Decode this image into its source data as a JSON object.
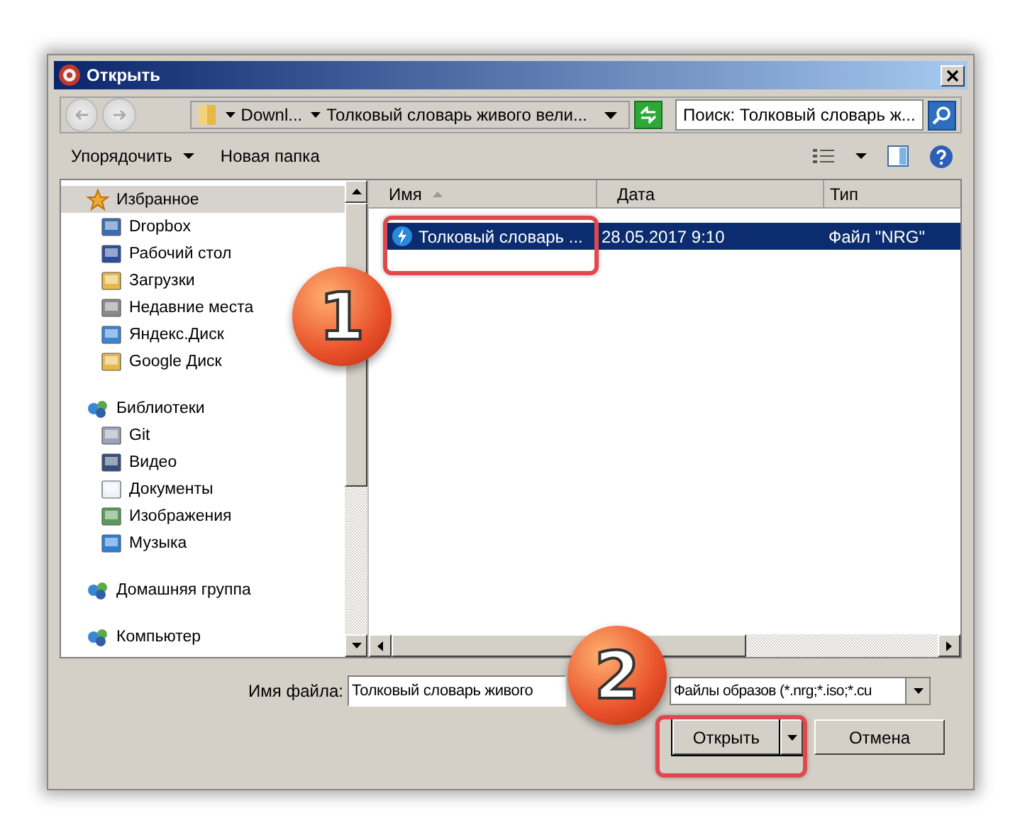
{
  "window": {
    "title": "Открыть"
  },
  "address": {
    "crumbs": [
      "Downl...",
      "Толковый словарь живого вели..."
    ]
  },
  "search": {
    "placeholder": "Поиск: Толковый словарь ж..."
  },
  "toolbar": {
    "organize": "Упорядочить",
    "new_folder": "Новая папка"
  },
  "nav": [
    {
      "label": "Избранное",
      "selected": true,
      "children": [
        {
          "label": "Dropbox",
          "selected": false
        },
        {
          "label": "Рабочий стол",
          "selected": false
        },
        {
          "label": "Загрузки",
          "selected": false
        },
        {
          "label": "Недавние места",
          "selected": false
        },
        {
          "label": "Яндекс.Диск",
          "selected": false
        },
        {
          "label": "Google Диск",
          "selected": false
        }
      ]
    },
    {
      "label": "Библиотеки",
      "selected": false,
      "children": [
        {
          "label": "Git",
          "selected": false
        },
        {
          "label": "Видео",
          "selected": false
        },
        {
          "label": "Документы",
          "selected": false
        },
        {
          "label": "Изображения",
          "selected": false
        },
        {
          "label": "Музыка",
          "selected": false
        }
      ]
    },
    {
      "label": "Домашняя группа",
      "selected": false
    },
    {
      "label": "Компьютер",
      "selected": false
    }
  ],
  "columns": [
    {
      "label": "Имя",
      "sorted": true
    },
    {
      "label": "Дата",
      "sorted": false
    },
    {
      "label": "Тип",
      "sorted": false
    }
  ],
  "rows": [
    {
      "name": "Толковый словарь ...",
      "date": "28.05.2017 9:10",
      "type": "Файл \"NRG\"",
      "selected": true
    }
  ],
  "filename": {
    "label": "Имя файла:",
    "value": "Толковый словарь живого"
  },
  "filter": {
    "value": "Файлы образов (*.nrg;*.iso;*.cu"
  },
  "buttons": {
    "open": "Открыть",
    "cancel": "Отмена"
  },
  "annotations": [
    {
      "label": "1"
    },
    {
      "label": "2"
    }
  ]
}
